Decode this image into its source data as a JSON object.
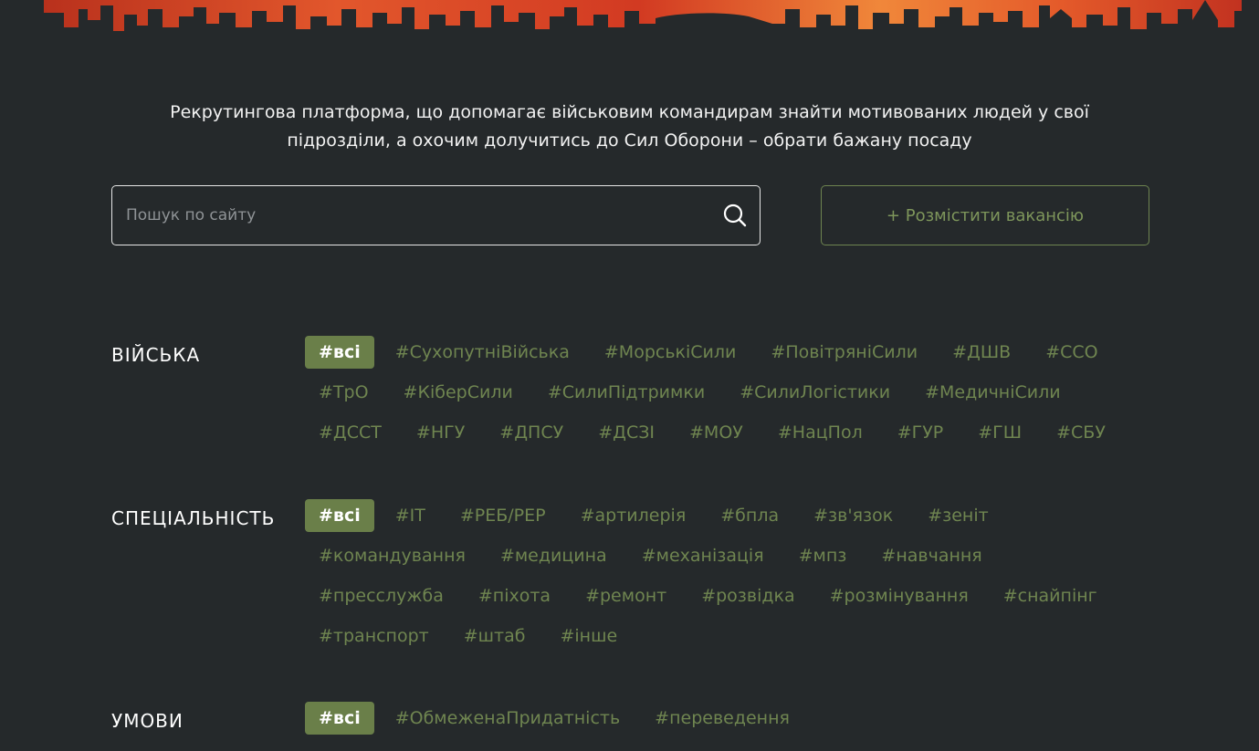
{
  "tagline": {
    "line1": "Рекрутингова платформа, що допомагає військовим командирам знайти мотивованих людей у свої",
    "line2": "підрозділи, а охочим долучитись до Сил Оборони – обрати бажану посаду"
  },
  "search": {
    "placeholder": "Пошук по сайту",
    "value": ""
  },
  "post_button": {
    "label": "+ Розмістити вакансію"
  },
  "filters": {
    "troops": {
      "title": "ВІЙСЬКА",
      "tags": [
        "#всі",
        "#СухопутніВійська",
        "#МорськіСили",
        "#ПовітряніСили",
        "#ДШВ",
        "#ССО",
        "#ТрО",
        "#КіберСили",
        "#СилиПідтримки",
        "#СилиЛогістики",
        "#МедичніСили",
        "#ДССТ",
        "#НГУ",
        "#ДПСУ",
        "#ДСЗІ",
        "#МОУ",
        "#НацПол",
        "#ГУР",
        "#ГШ",
        "#СБУ"
      ],
      "active_index": 0
    },
    "specialty": {
      "title": "СПЕЦІАЛЬНІСТЬ",
      "tags": [
        "#всі",
        "#IT",
        "#РЕБ/РЕР",
        "#артилерія",
        "#бпла",
        "#зв'язок",
        "#зеніт",
        "#командування",
        "#медицина",
        "#механізація",
        "#мпз",
        "#навчання",
        "#пресслужба",
        "#піхота",
        "#ремонт",
        "#розвідка",
        "#розмінування",
        "#снайпінг",
        "#транспорт",
        "#штаб",
        "#інше"
      ],
      "active_index": 0
    },
    "conditions": {
      "title": "УМОВИ",
      "tags": [
        "#всі",
        "#ОбмеженаПридатність",
        "#переведення"
      ],
      "active_index": 0
    }
  },
  "colors": {
    "background": "#25292b",
    "accent_green": "#6a7f49",
    "tag_text": "#6f8550",
    "fire_red": "#c8321e",
    "fire_orange": "#f08a3c"
  }
}
